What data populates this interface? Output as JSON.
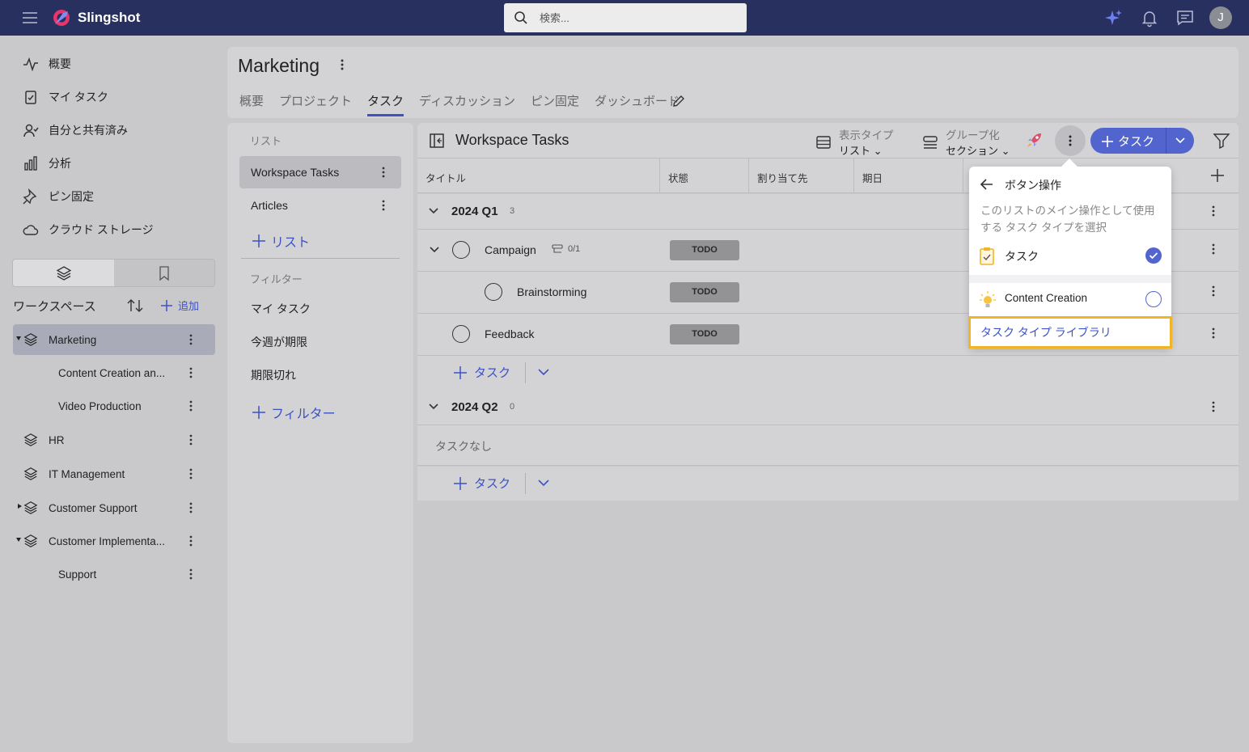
{
  "app": {
    "brand": "Slingshot",
    "search_placeholder": "検索...",
    "avatar_initial": "J",
    "accent_color": "#3d52c4",
    "highlight_color": "#f0b429"
  },
  "sidebar": {
    "nav": [
      {
        "label": "概要",
        "icon": "activity-icon"
      },
      {
        "label": "マイ タスク",
        "icon": "clipboard-check-icon"
      },
      {
        "label": "自分と共有済み",
        "icon": "user-shared-icon"
      },
      {
        "label": "分析",
        "icon": "bar-chart-icon"
      },
      {
        "label": "ピン固定",
        "icon": "pin-icon"
      },
      {
        "label": "クラウド ストレージ",
        "icon": "cloud-icon"
      }
    ],
    "workspaces_heading": "ワークスペース",
    "add_label": "追加",
    "workspaces": [
      {
        "label": "Marketing"
      },
      {
        "label": "Content Creation an..."
      },
      {
        "label": "Video Production"
      },
      {
        "label": "HR"
      },
      {
        "label": "IT Management"
      },
      {
        "label": "Customer Support"
      },
      {
        "label": "Customer Implementa..."
      },
      {
        "label": "Support"
      }
    ]
  },
  "header": {
    "title": "Marketing",
    "tabs": [
      "概要",
      "プロジェクト",
      "タスク",
      "ディスカッション",
      "ピン固定",
      "ダッシュボード"
    ],
    "active_tab": "タスク"
  },
  "lists_panel": {
    "lists_heading": "リスト",
    "lists": [
      "Workspace Tasks",
      "Articles"
    ],
    "add_list": "リスト",
    "filters_heading": "フィルター",
    "filters": [
      "マイ タスク",
      "今週が期限",
      "期限切れ"
    ],
    "add_filter": "フィルター"
  },
  "main": {
    "title": "Workspace Tasks",
    "view_type_label": "表示タイプ",
    "view_type_value": "リスト",
    "grouping_label": "グループ化",
    "grouping_value": "セクション",
    "add_task_label": "タスク",
    "columns": [
      "タイトル",
      "状態",
      "割り当て先",
      "期日"
    ],
    "groups": [
      {
        "name": "2024 Q1",
        "count": "3",
        "tasks": [
          {
            "title": "Campaign",
            "subtasks": "0/1",
            "status": "TODO"
          },
          {
            "title": "Brainstorming",
            "status": "TODO"
          },
          {
            "title": "Feedback",
            "status": "TODO"
          }
        ],
        "add_label": "タスク"
      },
      {
        "name": "2024 Q2",
        "count": "0",
        "empty_text": "タスクなし",
        "add_label": "タスク"
      }
    ]
  },
  "popup": {
    "title": "ボタン操作",
    "description": "このリストのメイン操作として使用する タスク タイプを選択",
    "options": [
      {
        "label": "タスク",
        "icon": "clipboard-task-icon",
        "selected": true
      },
      {
        "label": "Content Creation",
        "icon": "lightbulb-icon",
        "selected": false
      }
    ],
    "library_link": "タスク タイプ ライブラリ"
  }
}
